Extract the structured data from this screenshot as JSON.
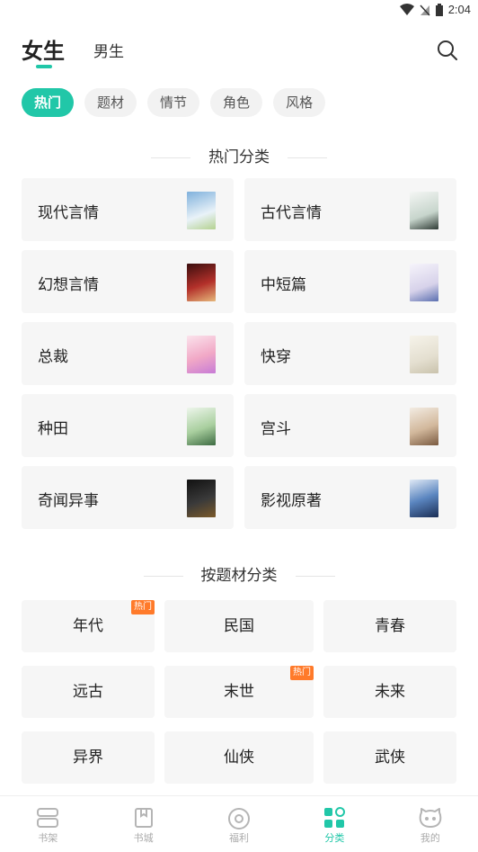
{
  "status_bar": {
    "time": "2:04"
  },
  "header": {
    "tabs": [
      {
        "label": "女生",
        "active": true
      },
      {
        "label": "男生",
        "active": false
      }
    ],
    "search_icon": "search-icon"
  },
  "chips": [
    "热门",
    "题材",
    "情节",
    "角色",
    "风格"
  ],
  "popular_section": {
    "title": "热门分类",
    "items": [
      {
        "label": "现代言情",
        "cover_color": "#b9d6ea"
      },
      {
        "label": "古代言情",
        "cover_color": "#dfe6e3"
      },
      {
        "label": "幻想言情",
        "cover_color": "#8a1f1f"
      },
      {
        "label": "中短篇",
        "cover_color": "#e8e6f0"
      },
      {
        "label": "总裁",
        "cover_color": "#f3c9d9"
      },
      {
        "label": "快穿",
        "cover_color": "#eeeae0"
      },
      {
        "label": "种田",
        "cover_color": "#d9ecd8"
      },
      {
        "label": "宫斗",
        "cover_color": "#d8c7b5"
      },
      {
        "label": "奇闻异事",
        "cover_color": "#1c1c1c"
      },
      {
        "label": "影视原著",
        "cover_color": "#2a4d7a"
      }
    ]
  },
  "theme_section": {
    "title": "按题材分类",
    "items": [
      {
        "label": "年代",
        "badge": "热门"
      },
      {
        "label": "民国",
        "badge": ""
      },
      {
        "label": "青春",
        "badge": ""
      },
      {
        "label": "远古",
        "badge": ""
      },
      {
        "label": "末世",
        "badge": "热门"
      },
      {
        "label": "未来",
        "badge": ""
      },
      {
        "label": "异界",
        "badge": ""
      },
      {
        "label": "仙侠",
        "badge": ""
      },
      {
        "label": "武侠",
        "badge": ""
      }
    ]
  },
  "bottom_nav": [
    {
      "label": "书架",
      "icon": "bookshelf-icon",
      "active": false
    },
    {
      "label": "书城",
      "icon": "bookstore-icon",
      "active": false
    },
    {
      "label": "福利",
      "icon": "welfare-icon",
      "active": false
    },
    {
      "label": "分类",
      "icon": "category-icon",
      "active": true
    },
    {
      "label": "我的",
      "icon": "profile-icon",
      "active": false
    }
  ],
  "colors": {
    "accent": "#21c7a8",
    "badge": "#ff7a2a",
    "card_bg": "#f6f6f6"
  }
}
